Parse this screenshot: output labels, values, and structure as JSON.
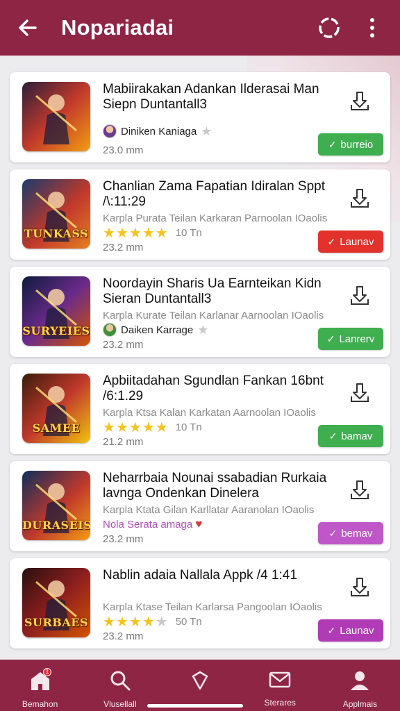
{
  "app_bar": {
    "title": "Nopariadai",
    "icons": {
      "back": "arrow-left-icon",
      "sync": "sync-icon",
      "more": "more-vertical-icon"
    }
  },
  "colors": {
    "brand": "#8e2545",
    "green": "#3fae4f",
    "red": "#e2322b",
    "purple": "#b04bbd",
    "star": "#f5c31b"
  },
  "cards": [
    {
      "title": "Mabiirakakan Adankan Ilderasai Man Siepn Duntantall3",
      "subtitle": "",
      "developer": "Diniken Kaniaga",
      "meta_type": "developer",
      "size": "23.0 mm",
      "action": "burreio",
      "action_color": "#3fae4f",
      "thumb_text": ""
    },
    {
      "title": "Chanlian Zama Fapatian Idiralan Sppt /\\:11:29",
      "subtitle": "Karpla Purata Teilan Karkaran Parnoolan IOaolis",
      "rating_value": 5,
      "rating_label": "10 Tn",
      "meta_type": "stars",
      "size": "23.2 mm",
      "action": "Launav",
      "action_color": "#e2322b",
      "thumb_text": "TUNKASS"
    },
    {
      "title": "Noordayin Sharis Ua Earnteikan Kidn Sieran Duntantall3",
      "subtitle": "Karpla Kurate Teilan Karlanar Aarnoolan IOaolis",
      "developer": "Daiken Karrage",
      "meta_type": "developer",
      "size": "23.2 mm",
      "action": "Lanrerv",
      "action_color": "#3fae4f",
      "thumb_text": "SURYEIES"
    },
    {
      "title": "Apbiitadahan Sgundlan Fankan 16bnt /6:1.29",
      "subtitle": "Karpla Ktsa Kalan Karkatan Aarnoolan IOaolis",
      "rating_value": 5,
      "rating_label": "10 Tn",
      "meta_type": "stars",
      "size": "21.2 mm",
      "action": "bamav",
      "action_color": "#3fae4f",
      "thumb_text": "SAMEE"
    },
    {
      "title": "Neharrbaia Nounai ssabadian Rurkaia lavnga Ondenkan Dinelera",
      "subtitle": "Karpla Ktata Gilan Karllatar Aaranolan IOaolis",
      "developer": "Nola Serata amaga",
      "meta_type": "purple",
      "size": "23.2 mm",
      "action": "bemav",
      "action_color": "#c057c8",
      "thumb_text": "DURASEIS"
    },
    {
      "title": "Nablin adaia Nallala Appk /4 1:41",
      "subtitle": "Karpla Ktase Teilan Karlarsa Pangoolan IOaolis",
      "rating_value": 4,
      "rating_label": "50 Tn",
      "meta_type": "stars",
      "size": "23.2 mm",
      "action": "Launav",
      "action_color": "#b13ab6",
      "thumb_text": "SURBAES"
    }
  ],
  "bottom_nav": [
    {
      "label": "Bemahon",
      "icon": "home-icon",
      "badge": "1"
    },
    {
      "label": "Vlusellall",
      "icon": "search-icon"
    },
    {
      "label": "",
      "icon": "shield-icon"
    },
    {
      "label": "Sterares",
      "icon": "mail-icon"
    },
    {
      "label": "Applmais",
      "icon": "user-icon"
    }
  ]
}
